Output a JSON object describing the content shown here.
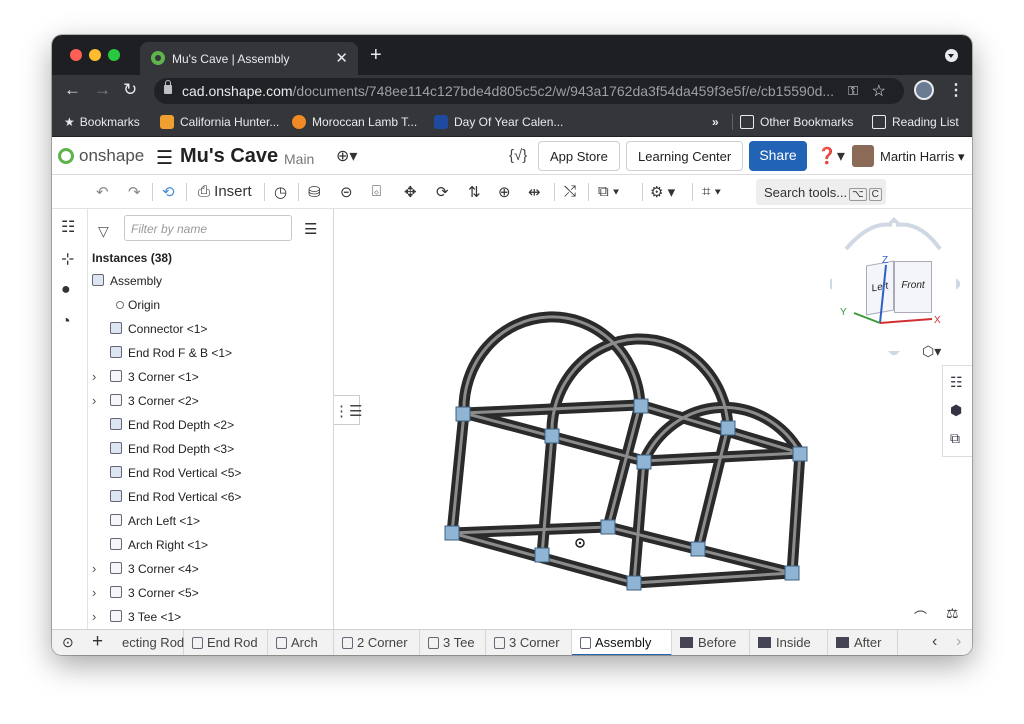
{
  "browser": {
    "tab_title": "Mu's Cave | Assembly",
    "url_host": "cad.onshape.com",
    "url_path": "/documents/748ee114c127bde4d805c5c2/w/943a1762da3f54da459f3e5f/e/cb15590d...",
    "bookmarks": [
      "Bookmarks",
      "California Hunter...",
      "Moroccan Lamb T...",
      "Day Of Year Calen..."
    ],
    "overflow": "»",
    "other_bookmarks": "Other Bookmarks",
    "reading_list": "Reading List"
  },
  "app": {
    "logo_text": "onshape",
    "doc_name": "Mu's Cave",
    "branch": "Main",
    "app_store": "App Store",
    "learning_center": "Learning Center",
    "share": "Share",
    "user_name": "Martin Harris",
    "brand_color": "#2163b5",
    "logo_color": "#5fb34a"
  },
  "toolbar": {
    "insert_label": "Insert",
    "search_tools": "Search tools...",
    "shortcut_key1": "⌥",
    "shortcut_key2": "C"
  },
  "panel": {
    "filter_placeholder": "Filter by name",
    "instances_header": "Instances (38)",
    "items": [
      {
        "label": "Assembly",
        "expandable": false,
        "icon": "assembly-icon"
      },
      {
        "label": "Origin",
        "expandable": false,
        "icon": "origin-icon"
      },
      {
        "label": "Connector <1>",
        "expandable": false,
        "icon": "part-icon"
      },
      {
        "label": "End Rod F & B <1>",
        "expandable": false,
        "icon": "part-icon"
      },
      {
        "label": "3 Corner <1>",
        "expandable": true,
        "icon": "subassembly-icon"
      },
      {
        "label": "3 Corner <2>",
        "expandable": true,
        "icon": "subassembly-icon"
      },
      {
        "label": "End Rod Depth <2>",
        "expandable": false,
        "icon": "part-icon"
      },
      {
        "label": "End Rod Depth <3>",
        "expandable": false,
        "icon": "part-icon"
      },
      {
        "label": "End Rod Vertical <5>",
        "expandable": false,
        "icon": "part-icon"
      },
      {
        "label": "End Rod Vertical <6>",
        "expandable": false,
        "icon": "part-icon"
      },
      {
        "label": "Arch Left <1>",
        "expandable": false,
        "icon": "subassembly-icon"
      },
      {
        "label": "Arch Right <1>",
        "expandable": false,
        "icon": "subassembly-icon"
      },
      {
        "label": "3 Corner <4>",
        "expandable": true,
        "icon": "subassembly-icon"
      },
      {
        "label": "3 Corner <5>",
        "expandable": true,
        "icon": "subassembly-icon"
      },
      {
        "label": "3 Tee <1>",
        "expandable": true,
        "icon": "subassembly-icon"
      }
    ]
  },
  "viewcube": {
    "left": "Left",
    "front": "Front",
    "axis_x": "X",
    "axis_y": "Y",
    "axis_z": "Z"
  },
  "bottom_tabs": [
    {
      "label": "ecting Rod",
      "kind": "part",
      "active": false
    },
    {
      "label": "End Rod",
      "kind": "part",
      "active": false
    },
    {
      "label": "Arch",
      "kind": "part",
      "active": false
    },
    {
      "label": "2 Corner",
      "kind": "part",
      "active": false
    },
    {
      "label": "3 Tee",
      "kind": "part",
      "active": false
    },
    {
      "label": "3 Corner",
      "kind": "part",
      "active": false
    },
    {
      "label": "Assembly",
      "kind": "assembly",
      "active": true
    },
    {
      "label": "Before",
      "kind": "image",
      "active": false
    },
    {
      "label": "Inside",
      "kind": "image",
      "active": false
    },
    {
      "label": "After",
      "kind": "image",
      "active": false
    }
  ]
}
